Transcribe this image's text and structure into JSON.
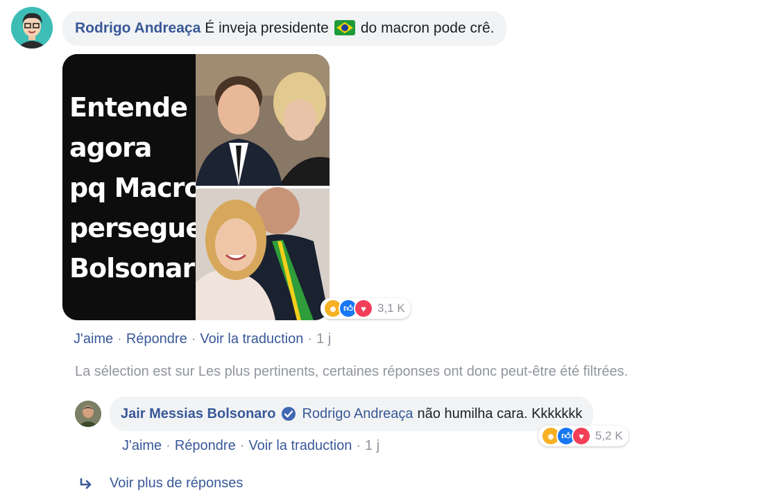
{
  "comment": {
    "author": "Rodrigo Andreaça",
    "text_before_flag": "É inveja presidente",
    "flag_icon": "brazil-flag-icon",
    "text_after_flag": "do macron pode crê.",
    "image_text_lines": [
      "Entende",
      "agora",
      "pq Macron",
      "persegue",
      "Bolsonaro?"
    ],
    "reactions": {
      "icons": [
        "haha-reaction-icon",
        "like-reaction-icon",
        "love-reaction-icon"
      ],
      "count": "3,1 K"
    },
    "actions": {
      "like": "J'aime",
      "reply": "Répondre",
      "translate": "Voir la traduction",
      "time": "1 j"
    }
  },
  "filter_notice": "La sélection est sur Les plus pertinents, certaines réponses ont donc peut-être été filtrées.",
  "reply": {
    "author": "Jair Messias Bolsonaro",
    "verified_icon": "verified-badge-icon",
    "mention": "Rodrigo Andreaça",
    "text": "não humilha cara. Kkkkkkk",
    "reactions": {
      "icons": [
        "haha-reaction-icon",
        "like-reaction-icon",
        "love-reaction-icon"
      ],
      "count": "5,2 K"
    },
    "actions": {
      "like": "J'aime",
      "reply": "Répondre",
      "translate": "Voir la traduction",
      "time": "1 j"
    }
  },
  "more_replies": {
    "icon": "reply-arrow-icon",
    "label": "Voir plus de réponses"
  },
  "colors": {
    "link": "#385898",
    "muted": "#90949c",
    "bubble": "#f2f3f5",
    "verified": "#1877f2"
  }
}
